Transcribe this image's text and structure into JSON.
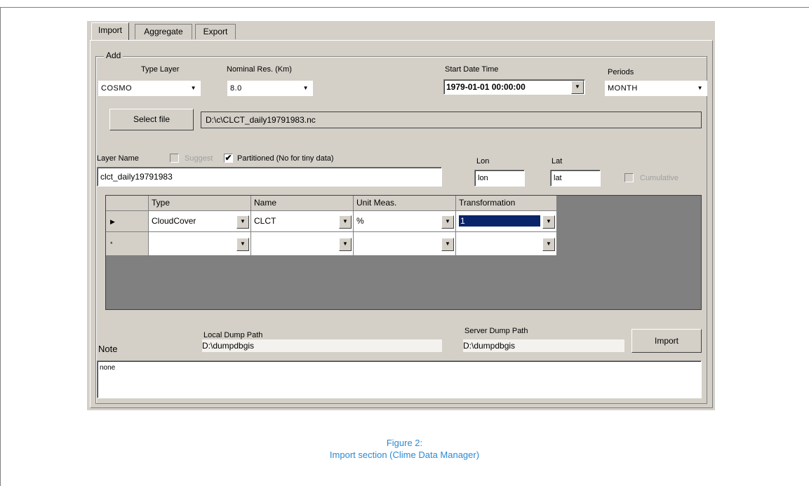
{
  "tabs": [
    "Import",
    "Aggregate",
    "Export"
  ],
  "group_title": "Add",
  "type_layer": {
    "label": "Type Layer",
    "value": "COSMO"
  },
  "nominal_res": {
    "label": "Nominal Res. (Km)",
    "value": "8.0"
  },
  "start_datetime": {
    "label": "Start Date Time",
    "value": "1979-01-01  00:00:00"
  },
  "periods": {
    "label": "Periods",
    "value": "MONTH"
  },
  "select_file": {
    "button": "Select file",
    "path": "D:\\c\\CLCT_daily19791983.nc"
  },
  "layer_name": {
    "label": "Layer Name",
    "value": "clct_daily19791983"
  },
  "suggest": {
    "label": "Suggest",
    "checked": false
  },
  "partitioned": {
    "label": "Partitioned (No for tiny data)",
    "checked": true
  },
  "lon": {
    "label": "Lon",
    "value": "lon"
  },
  "lat": {
    "label": "Lat",
    "value": "lat"
  },
  "cumulative": {
    "label": "Cumulative",
    "checked": false
  },
  "grid": {
    "columns": [
      "Type",
      "Name",
      "Unit Meas.",
      "Transformation"
    ],
    "rows": [
      {
        "marker": "▶",
        "type": "CloudCover",
        "name": "CLCT",
        "unit": "%",
        "transformation": "1"
      },
      {
        "marker": "*",
        "type": "",
        "name": "",
        "unit": "",
        "transformation": ""
      }
    ]
  },
  "local_dump": {
    "label": "Local Dump Path",
    "value": "D:\\dumpdbgis"
  },
  "server_dump": {
    "label": "Server Dump Path",
    "value": "D:\\dumpdbgis"
  },
  "import_button": "Import",
  "note": {
    "label": "Note",
    "value": "none"
  },
  "caption": {
    "line1": "Figure 2:",
    "line2": "Import section (Clime Data Manager)"
  },
  "icons": {
    "dropdown": "▼",
    "row_current": "▶"
  }
}
